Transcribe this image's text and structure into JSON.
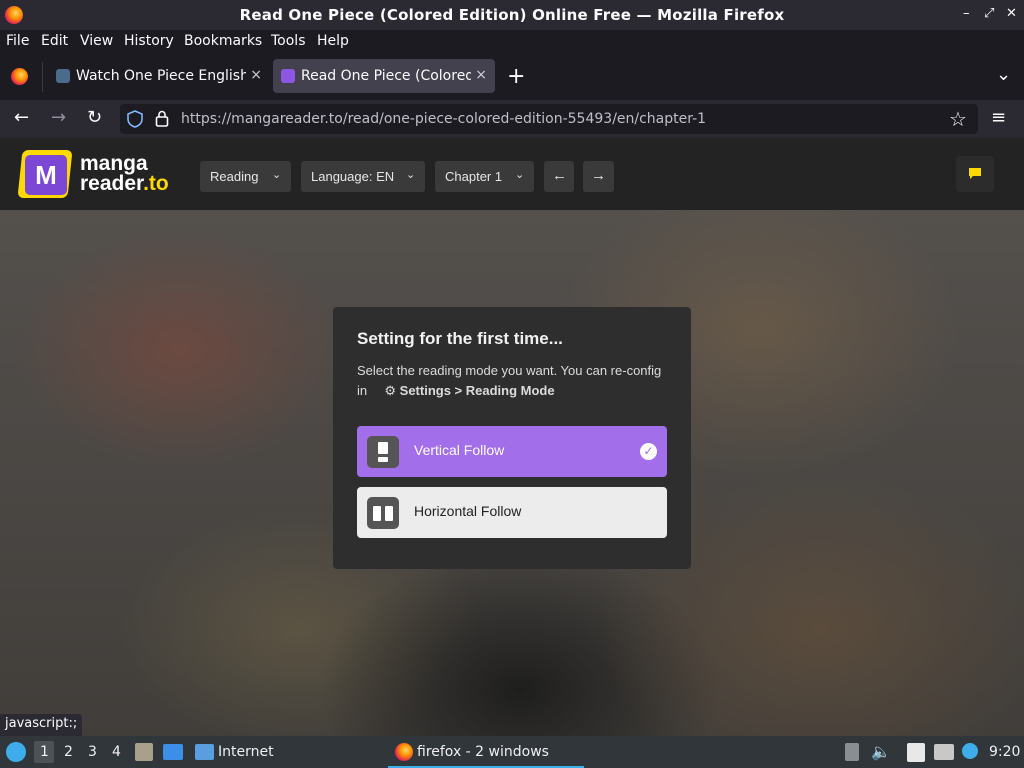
{
  "window": {
    "title": "Read One Piece (Colored Edition) Online Free — Mozilla Firefox",
    "controls": {
      "minimize": "–",
      "restore": "⤢",
      "close": "✕"
    }
  },
  "menu": [
    "File",
    "Edit",
    "View",
    "History",
    "Bookmarks",
    "Tools",
    "Help"
  ],
  "tabs": [
    {
      "label": "Watch One Piece English",
      "close": "×"
    },
    {
      "label": "Read One Piece (Colored",
      "close": "×"
    }
  ],
  "tabstrip": {
    "new_tab": "+",
    "list_all": "⌄"
  },
  "navbar": {
    "back": "←",
    "forward": "→",
    "reload": "↻",
    "url_host": "https://mangareader.to",
    "url_path": "/read/one-piece-colored-edition-55493/en/chapter-1",
    "bookmark": "☆",
    "menu": "≡"
  },
  "site": {
    "logo_mark": "M",
    "logo_line1": "manga",
    "logo_line2_a": "reader",
    "logo_line2_b": ".to",
    "reading_btn": "Reading",
    "language_btn": "Language: EN",
    "chapter_btn": "Chapter 1",
    "prev": "←",
    "next": "→",
    "accent": "#ffd800",
    "purple": "#9c6ee9"
  },
  "modal": {
    "title": "Setting for the first time...",
    "desc_a": "Select the reading mode you want. You can re-config in",
    "desc_b": "Settings > Reading Mode",
    "options": [
      {
        "label": "Vertical Follow",
        "selected": true
      },
      {
        "label": "Horizontal Follow",
        "selected": false
      }
    ]
  },
  "status_tip": "javascript:;",
  "taskbar": {
    "workspaces": [
      "1",
      "2",
      "3",
      "4"
    ],
    "places_label": "Internet",
    "task_label": "firefox - 2 windows",
    "clock": "9:20"
  }
}
